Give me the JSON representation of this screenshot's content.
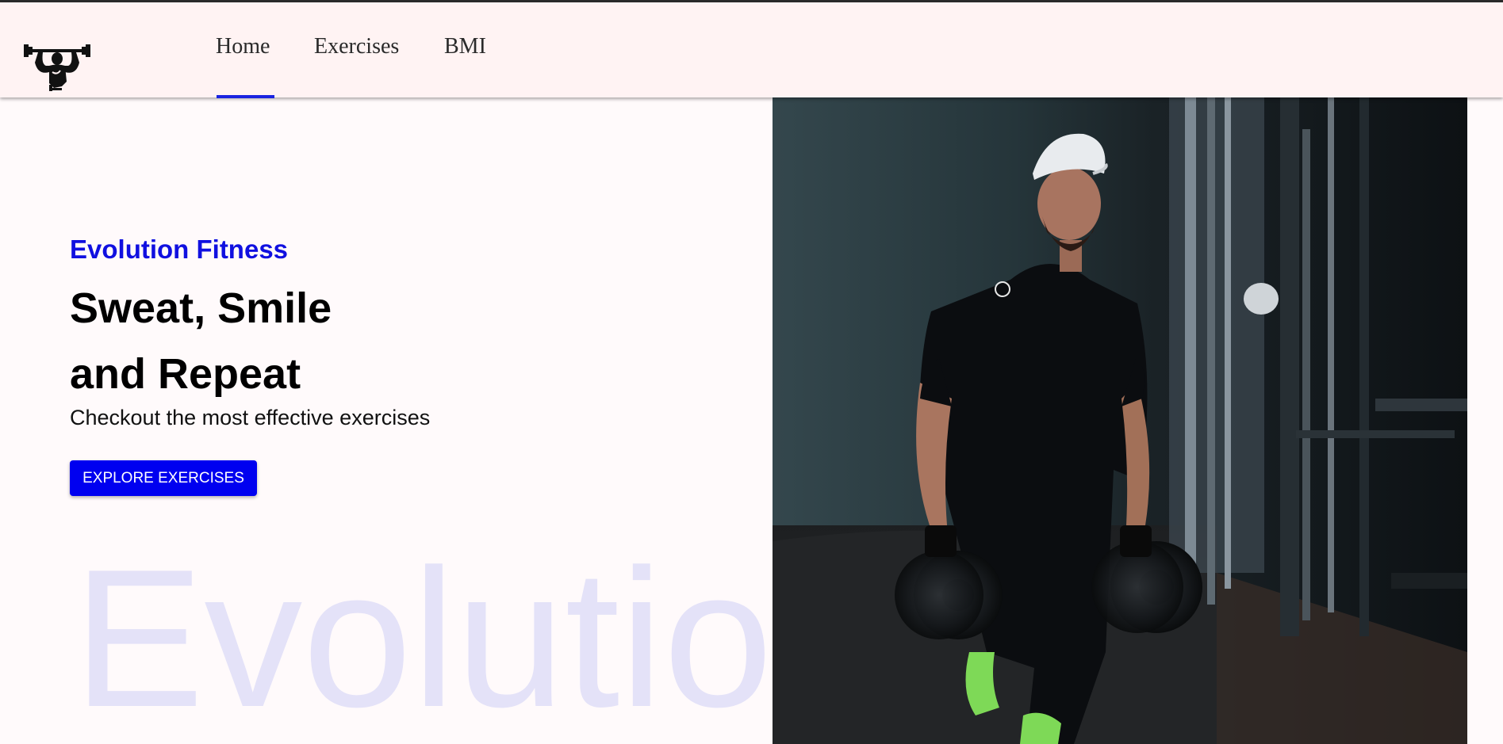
{
  "nav": {
    "logo": "weightlifter-logo",
    "items": [
      {
        "label": "Home",
        "active": true
      },
      {
        "label": "Exercises",
        "active": false
      },
      {
        "label": "BMI",
        "active": false
      }
    ]
  },
  "hero": {
    "brand": "Evolution Fitness",
    "title_line1": "Sweat, Smile",
    "title_line2": "and Repeat",
    "subtitle": "Checkout the most effective exercises",
    "cta_label": "EXPLORE EXERCISES",
    "watermark": "Evolution",
    "image": "man-lunging-with-dumbbells-photo"
  },
  "colors": {
    "accent": "#0000f0",
    "brand_text": "#1010e0",
    "navbar_bg": "#fff3f3",
    "page_bg": "#fffafb",
    "watermark": "#e4e2f8"
  }
}
